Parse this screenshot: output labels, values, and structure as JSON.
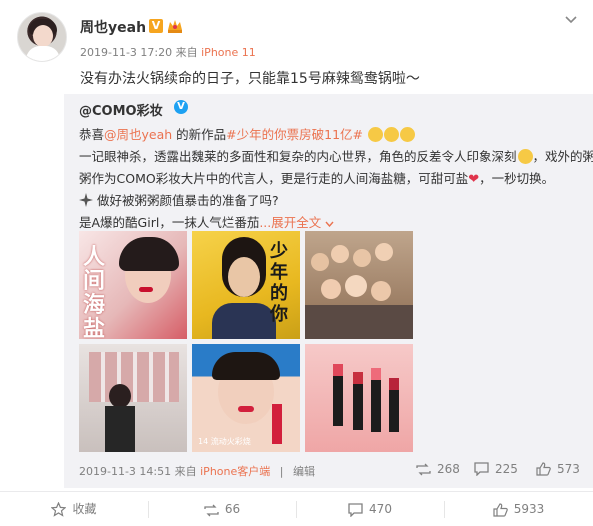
{
  "post": {
    "username": "周也yeah",
    "badge": "V",
    "timestamp": "2019-11-3 17:20",
    "source_prefix": "来自",
    "device": "iPhone 11",
    "text": "没有办法火锅续命的日子，只能靠15号麻辣鸳鸯锅啦～"
  },
  "repost": {
    "author": "@COMO彩妆",
    "line1": {
      "prefix": "恭喜",
      "mention": "@周也yeah",
      "middle": " 的新作品",
      "hashtag": "#少年的你票房破11亿#"
    },
    "line2": "一记眼神杀，透露出魏莱的多面性和复杂的内心世界，角色的反差令人印象深刻",
    "line2_tail": "，戏外的粥",
    "line3": "粥作为COMO彩妆大片中的代言人，更是行走的人间海盐糖，可甜可盐",
    "line3_tail": "，一秒切换。",
    "line4": "做好被粥粥颜值暴击的准备了吗?",
    "line5_prefix": "是A爆的酷Girl，一抹人气烂番茄",
    "line5_more": "...展开全文",
    "line5_more_icon": "chevron-down-icon",
    "images": [
      {
        "label": "人间海盐糖"
      },
      {
        "label": "少年的你"
      },
      {
        "label": ""
      },
      {
        "label": ""
      },
      {
        "label": "14 流动火彩烧"
      },
      {
        "label": ""
      }
    ],
    "footer": {
      "timestamp": "2019-11-3 14:51",
      "source_prefix": "来自",
      "device": "iPhone客户端",
      "edited_separator": "|",
      "edited": "编辑"
    },
    "stats": {
      "reposts": "268",
      "comments": "225",
      "likes": "573"
    }
  },
  "actions": {
    "favorite": "收藏",
    "repost": "66",
    "comment": "470",
    "like": "5933"
  },
  "colors": {
    "accent": "#eb7350",
    "vip_badge": "#f6a51f",
    "verified_blue": "#1da1f2",
    "repost_bg": "#f2f2f5"
  }
}
